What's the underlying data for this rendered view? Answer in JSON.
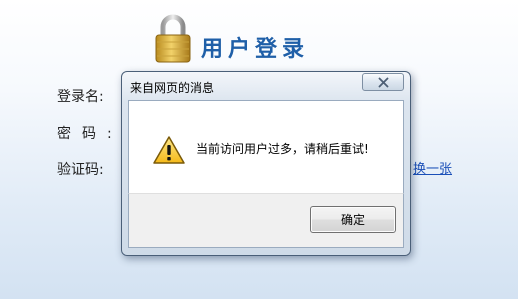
{
  "login": {
    "title": "用户登录",
    "labels": {
      "username": "登录名:",
      "password": "密码:",
      "captcha": "验证码:"
    },
    "refresh_link": "换一张"
  },
  "dialog": {
    "title": "来自网页的消息",
    "message": "当前访问用户过多，请稍后重试!",
    "ok_label": "确定",
    "icon": "warning-icon",
    "close_icon": "close-icon"
  },
  "colors": {
    "title_blue": "#1f5fa8",
    "link_blue": "#1a4fb8",
    "warning_yellow": "#f5c320"
  }
}
